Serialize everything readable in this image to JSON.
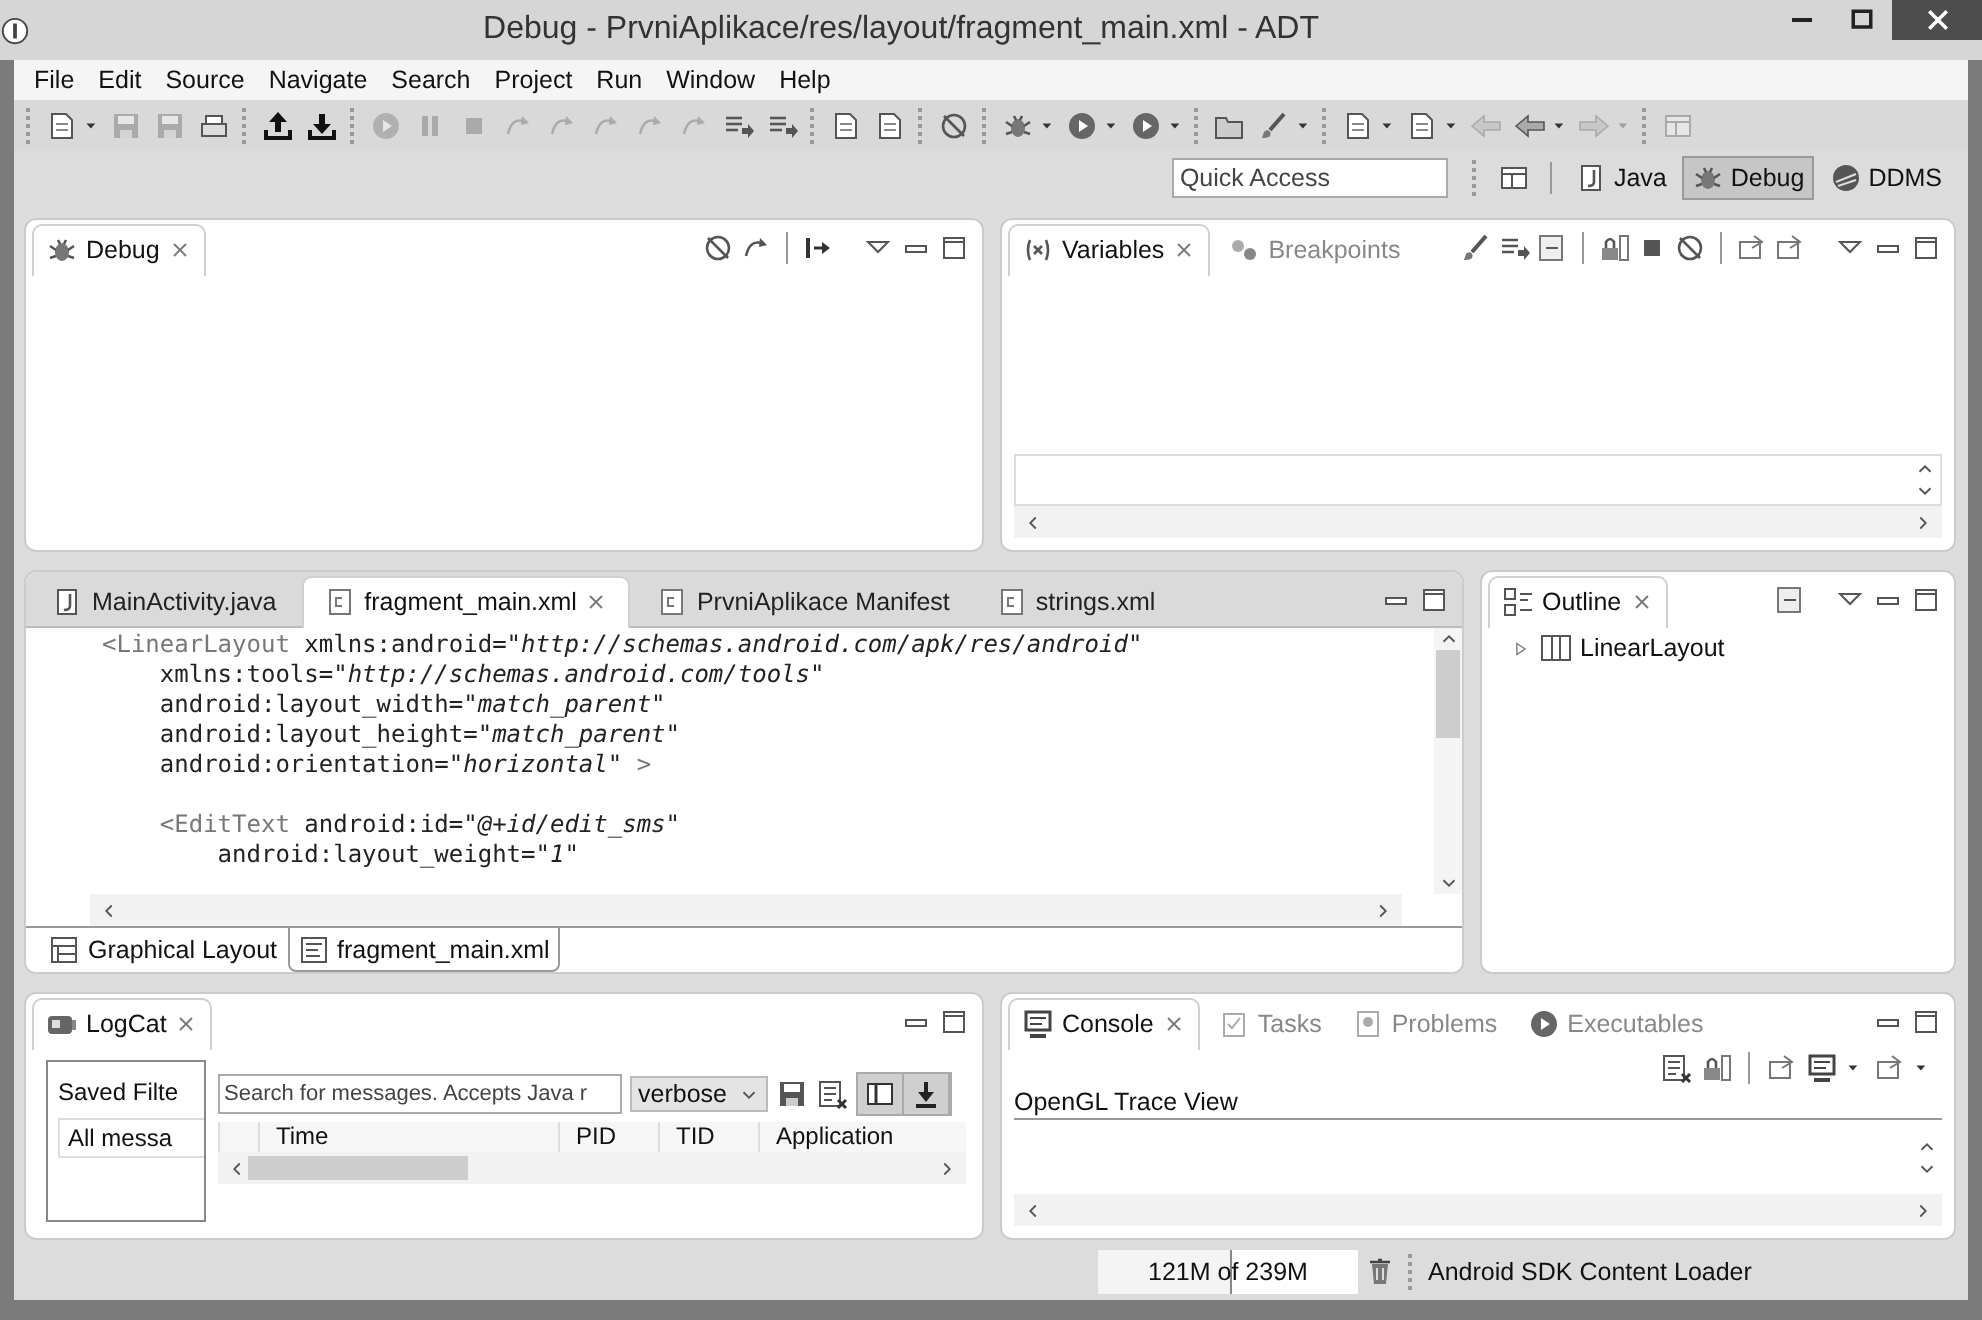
{
  "window": {
    "title": "Debug - PrvniAplikace/res/layout/fragment_main.xml - ADT"
  },
  "menu": [
    "File",
    "Edit",
    "Source",
    "Navigate",
    "Search",
    "Project",
    "Run",
    "Window",
    "Help"
  ],
  "toolbar_groups": [
    [
      {
        "kind": "doc",
        "disabled": false,
        "dropdown": true
      },
      {
        "kind": "save",
        "disabled": true,
        "dropdown": false
      },
      {
        "kind": "save",
        "disabled": true,
        "dropdown": false
      },
      {
        "kind": "print",
        "disabled": false,
        "dropdown": false
      }
    ],
    [
      {
        "kind": "upload",
        "disabled": false,
        "dropdown": false
      },
      {
        "kind": "download",
        "disabled": false,
        "dropdown": false
      }
    ],
    [
      {
        "kind": "play",
        "disabled": true,
        "dropdown": false
      },
      {
        "kind": "pause",
        "disabled": true,
        "dropdown": false
      },
      {
        "kind": "stop",
        "disabled": true,
        "dropdown": false
      },
      {
        "kind": "step",
        "disabled": true,
        "dropdown": false
      },
      {
        "kind": "step",
        "disabled": true,
        "dropdown": false
      },
      {
        "kind": "step",
        "disabled": true,
        "dropdown": false
      },
      {
        "kind": "step",
        "disabled": true,
        "dropdown": false
      },
      {
        "kind": "step",
        "disabled": true,
        "dropdown": false
      },
      {
        "kind": "list",
        "disabled": false,
        "dropdown": false
      },
      {
        "kind": "list",
        "disabled": false,
        "dropdown": false
      }
    ],
    [
      {
        "kind": "doc",
        "disabled": false,
        "dropdown": false
      },
      {
        "kind": "doc",
        "disabled": false,
        "dropdown": false
      }
    ],
    [
      {
        "kind": "noentry",
        "disabled": false,
        "dropdown": false
      }
    ],
    [
      {
        "kind": "bug",
        "disabled": false,
        "dropdown": true
      },
      {
        "kind": "play",
        "disabled": false,
        "dropdown": true
      },
      {
        "kind": "play",
        "disabled": false,
        "dropdown": true
      }
    ],
    [
      {
        "kind": "folder",
        "disabled": false,
        "dropdown": false
      },
      {
        "kind": "brush",
        "disabled": false,
        "dropdown": true
      }
    ],
    [
      {
        "kind": "doc",
        "disabled": false,
        "dropdown": true
      },
      {
        "kind": "doc",
        "disabled": false,
        "dropdown": true
      },
      {
        "kind": "left",
        "disabled": true,
        "dropdown": false
      },
      {
        "kind": "left",
        "disabled": false,
        "dropdown": true
      },
      {
        "kind": "right",
        "disabled": true,
        "dropdown": true
      }
    ],
    [
      {
        "kind": "window",
        "disabled": true,
        "dropdown": false
      }
    ]
  ],
  "quick_access": {
    "placeholder": "Quick Access"
  },
  "perspectives": [
    {
      "label": "Java",
      "selected": false,
      "kind": "java"
    },
    {
      "label": "Debug",
      "selected": true,
      "kind": "bug"
    },
    {
      "label": "DDMS",
      "selected": false,
      "kind": "ddms"
    }
  ],
  "debug_view": {
    "tabs": [
      {
        "label": "Debug",
        "selected": true,
        "kind": "bug"
      }
    ]
  },
  "variables_view": {
    "tabs": [
      {
        "label": "Variables",
        "selected": true,
        "kind": "vars"
      },
      {
        "label": "Breakpoints",
        "selected": false,
        "kind": "dots"
      }
    ]
  },
  "editor": {
    "tabs": [
      {
        "label": "MainActivity.java",
        "selected": false,
        "kind": "java"
      },
      {
        "label": "fragment_main.xml",
        "selected": true,
        "kind": "xml"
      },
      {
        "label": "PrvniAplikace Manifest",
        "selected": false,
        "kind": "xml"
      },
      {
        "label": "strings.xml",
        "selected": false,
        "kind": "xml"
      }
    ],
    "lines": [
      {
        "kind": "code",
        "spans": [
          {
            "text": "<LinearLayout",
            "kind": "tag"
          },
          {
            "text": " xmlns:android=",
            "kind": "attr"
          },
          {
            "text": "\"http://schemas.android.com/apk/res/android\"",
            "kind": "value"
          }
        ]
      },
      {
        "kind": "code",
        "spans": [
          {
            "text": "    xmlns:tools=",
            "kind": "attr"
          },
          {
            "text": "\"http://schemas.android.com/tools\"",
            "kind": "value"
          }
        ]
      },
      {
        "kind": "code",
        "spans": [
          {
            "text": "    android:layout_width=",
            "kind": "attr"
          },
          {
            "text": "\"match_parent\"",
            "kind": "value"
          }
        ]
      },
      {
        "kind": "code",
        "spans": [
          {
            "text": "    android:layout_height=",
            "kind": "attr"
          },
          {
            "text": "\"match_parent\"",
            "kind": "value"
          }
        ]
      },
      {
        "kind": "code",
        "spans": [
          {
            "text": "    android:orientation=",
            "kind": "attr"
          },
          {
            "text": "\"horizontal\"",
            "kind": "value"
          },
          {
            "text": " >",
            "kind": "tag"
          }
        ]
      },
      {
        "kind": "blank"
      },
      {
        "kind": "code",
        "spans": [
          {
            "text": "    <EditText",
            "kind": "tag"
          },
          {
            "text": " android:id=",
            "kind": "attr"
          },
          {
            "text": "\"@+id/edit_sms\"",
            "kind": "value"
          }
        ]
      },
      {
        "kind": "code",
        "spans": [
          {
            "text": "        android:layout_weight=",
            "kind": "attr"
          },
          {
            "text": "\"1\"",
            "kind": "value"
          }
        ]
      }
    ],
    "bottom_tabs": [
      {
        "label": "Graphical Layout",
        "selected": false,
        "kind": "layout"
      },
      {
        "label": "fragment_main.xml",
        "selected": true,
        "kind": "source"
      }
    ]
  },
  "outline": {
    "tabs": [
      {
        "label": "Outline",
        "selected": true,
        "kind": "outline"
      }
    ],
    "tree": [
      {
        "label": "LinearLayout",
        "expanded": false
      }
    ]
  },
  "logcat": {
    "tabs": [
      {
        "label": "LogCat",
        "selected": true,
        "kind": "logcat"
      }
    ],
    "saved_filters": "Saved Filte",
    "filters": [
      "All messa"
    ],
    "search": {
      "placeholder": "Search for messages. Accepts Java r"
    },
    "level": "verbose",
    "columns": [
      "Time",
      "PID",
      "TID",
      "Application"
    ]
  },
  "console": {
    "tabs": [
      {
        "label": "Console",
        "selected": true,
        "kind": "console"
      },
      {
        "label": "Tasks",
        "selected": false,
        "kind": "tasks"
      },
      {
        "label": "Problems",
        "selected": false,
        "kind": "problems"
      },
      {
        "label": "Executables",
        "selected": false,
        "kind": "play"
      }
    ],
    "label": "OpenGL Trace View"
  },
  "status_bar": {
    "memory": "121M of 239M",
    "level": 0.51,
    "job": "Android SDK Content Loader"
  }
}
